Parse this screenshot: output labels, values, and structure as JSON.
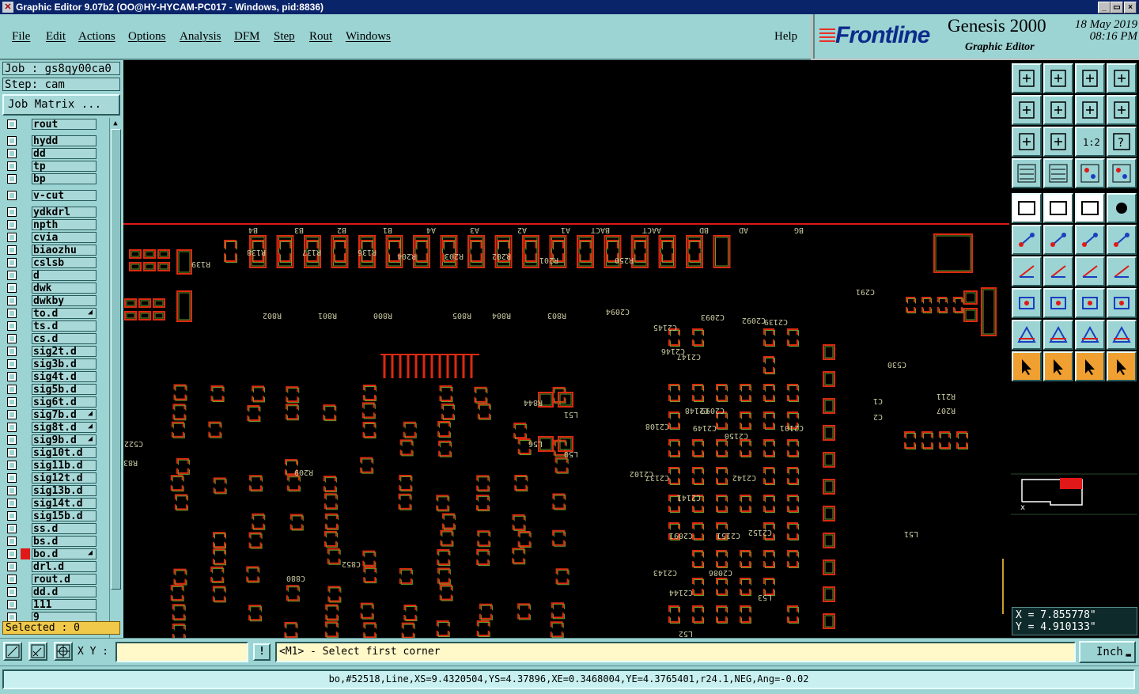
{
  "window": {
    "title": "Graphic Editor 9.07b2 (OO@HY-HYCAM-PC017 - Windows, pid:8836)",
    "controls": [
      "_",
      "▭",
      "×"
    ]
  },
  "menu": {
    "items": [
      "File",
      "Edit",
      "Actions",
      "Options",
      "Analysis",
      "DFM",
      "Step",
      "Rout",
      "Windows"
    ],
    "help": "Help"
  },
  "brand": {
    "logo": "Frontline",
    "product": "Genesis 2000",
    "subtitle": "Graphic Editor",
    "date": "18 May 2019",
    "time": "08:16 PM"
  },
  "job": {
    "job_label": "Job : gs8qy00ca0",
    "step_label": "Step: cam",
    "matrix_button": "Job Matrix ..."
  },
  "layers": [
    {
      "name": "rout",
      "marker": ""
    },
    {
      "name": "hydd",
      "marker": ""
    },
    {
      "name": "dd",
      "marker": ""
    },
    {
      "name": "tp",
      "marker": ""
    },
    {
      "name": "bp",
      "marker": ""
    },
    {
      "name": "v-cut",
      "marker": ""
    },
    {
      "name": "ydkdrl",
      "marker": ""
    },
    {
      "name": "npth",
      "marker": ""
    },
    {
      "name": "cvia",
      "marker": ""
    },
    {
      "name": "biaozhu",
      "marker": ""
    },
    {
      "name": "cslsb",
      "marker": ""
    },
    {
      "name": "d",
      "marker": ""
    },
    {
      "name": "dwk",
      "marker": ""
    },
    {
      "name": "dwkby",
      "marker": ""
    },
    {
      "name": "to.d",
      "marker": "◢"
    },
    {
      "name": "ts.d",
      "marker": ""
    },
    {
      "name": "cs.d",
      "marker": ""
    },
    {
      "name": "sig2t.d",
      "marker": ""
    },
    {
      "name": "sig3b.d",
      "marker": ""
    },
    {
      "name": "sig4t.d",
      "marker": ""
    },
    {
      "name": "sig5b.d",
      "marker": ""
    },
    {
      "name": "sig6t.d",
      "marker": ""
    },
    {
      "name": "sig7b.d",
      "marker": "◢"
    },
    {
      "name": "sig8t.d",
      "marker": "◢"
    },
    {
      "name": "sig9b.d",
      "marker": "◢"
    },
    {
      "name": "sig10t.d",
      "marker": ""
    },
    {
      "name": "sig11b.d",
      "marker": ""
    },
    {
      "name": "sig12t.d",
      "marker": ""
    },
    {
      "name": "sig13b.d",
      "marker": ""
    },
    {
      "name": "sig14t.d",
      "marker": ""
    },
    {
      "name": "sig15b.d",
      "marker": ""
    },
    {
      "name": "ss.d",
      "marker": ""
    },
    {
      "name": "bs.d",
      "marker": ""
    },
    {
      "name": "bo.d",
      "marker": "◢",
      "active": true
    },
    {
      "name": "drl.d",
      "marker": ""
    },
    {
      "name": "rout.d",
      "marker": ""
    },
    {
      "name": "dd.d",
      "marker": ""
    },
    {
      "name": "111",
      "marker": ""
    },
    {
      "name": "9",
      "marker": ""
    }
  ],
  "selected": "Selected : 0",
  "coords": {
    "x": "X = 7.855778\"",
    "y": "Y = 4.910133\""
  },
  "bottom": {
    "xy_label": "X Y :",
    "xy_value": "",
    "excl": "!",
    "prompt": "<M1> - Select first corner",
    "unit": "Inch"
  },
  "status": "bo,#52518,Line,XS=9.4320504,YS=4.37896,XE=0.3468004,YE=4.3765401,r24.1,NEG,Ang=-0.02",
  "canvas_labels": [
    "B4",
    "B3",
    "B2",
    "B1",
    "A4",
    "A3",
    "A2",
    "A1",
    "BACT",
    "AACT",
    "BD",
    "AD",
    "BG",
    "R138",
    "R137",
    "R136",
    "R204",
    "R203",
    "R202",
    "R201",
    "R139",
    "R250",
    "C291",
    "R802",
    "R801",
    "R800",
    "R805",
    "R804",
    "R803",
    "C2094",
    "C2093",
    "C2092",
    "C2139",
    "C2145",
    "C2146",
    "C2147",
    "C2148",
    "C2099",
    "C2108",
    "C2149",
    "C2150",
    "C2101",
    "C2102",
    "C2137",
    "C2142",
    "C2141",
    "C2091",
    "C2151",
    "C2152",
    "C2143",
    "C2086",
    "C2144",
    "L53",
    "L52",
    "L51",
    "L50",
    "C880",
    "C852",
    "R844",
    "L56",
    "R836",
    "C522",
    "R209",
    "C530",
    "R211",
    "R207",
    "C1",
    "C2",
    "L51"
  ],
  "colors": {
    "accent": "#9cd3d3",
    "canvas": "#000000",
    "pad_outer": "#dc2a10",
    "pad_inner": "#6a9a2a",
    "board_edge": "#e01818",
    "selected_box": "#f0c84a"
  }
}
